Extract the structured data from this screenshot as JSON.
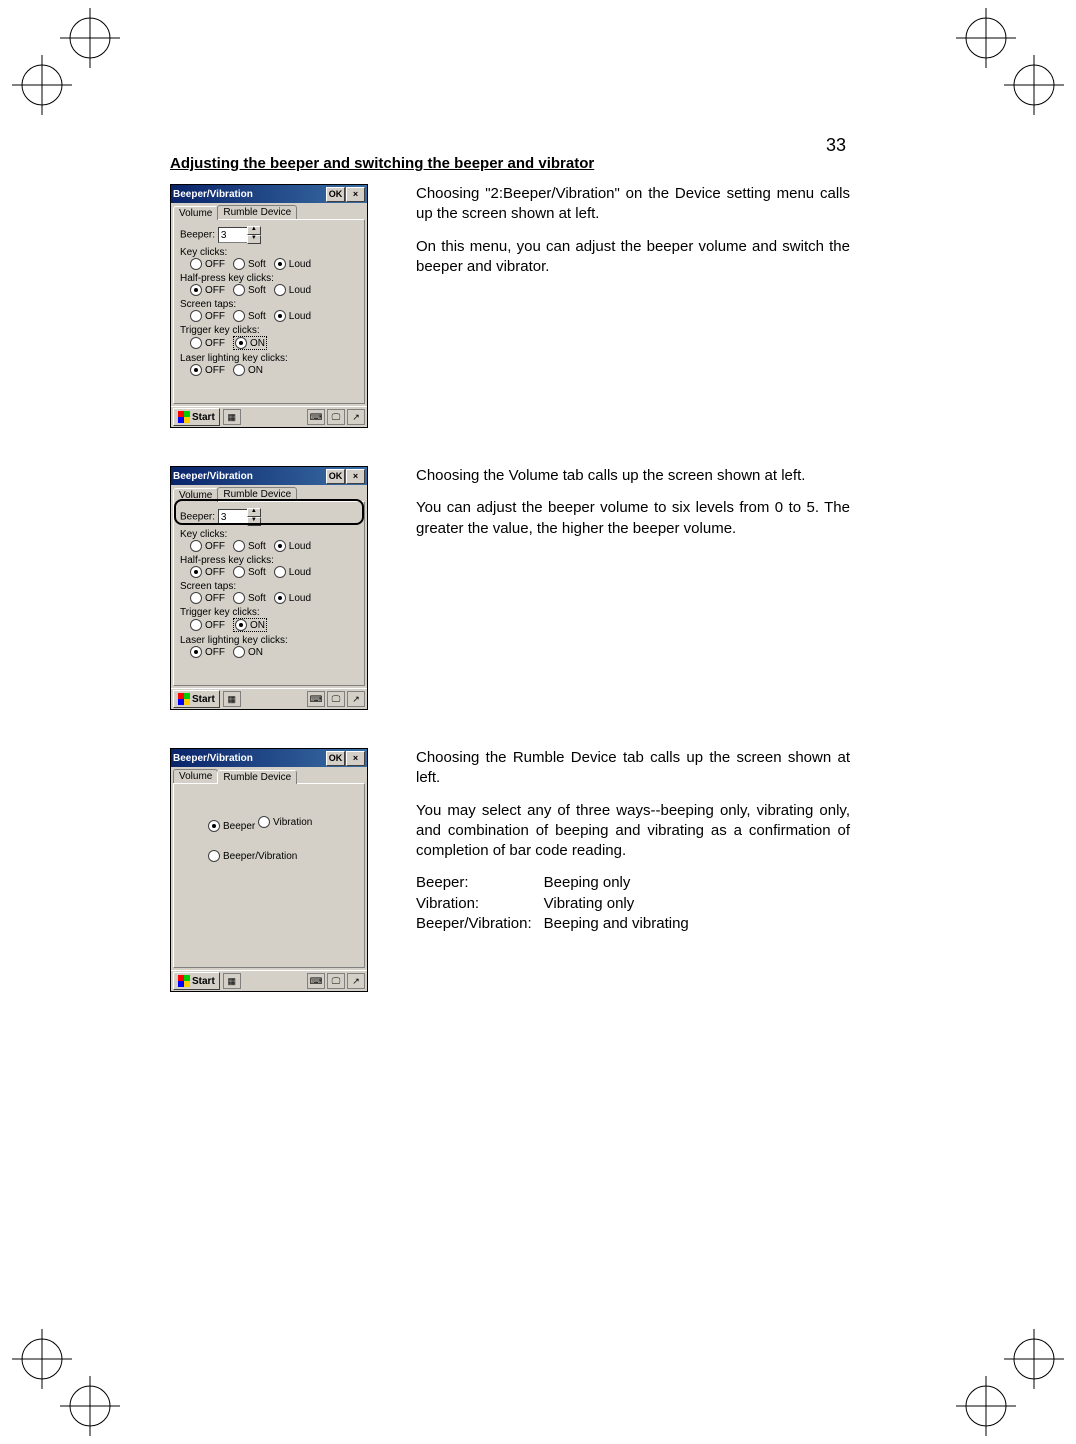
{
  "page_number": "33",
  "section_title": "Adjusting the beeper and switching the beeper and vibrator",
  "blocks": [
    {
      "paragraphs": [
        "Choosing \"2:Beeper/Vibration\" on the Device setting menu calls up the screen shown at left.",
        "On this menu, you can adjust the beeper volume and switch the beeper and vibrator."
      ]
    },
    {
      "paragraphs": [
        "Choosing the Volume tab calls up the screen shown at left.",
        "You can adjust the beeper volume to six levels from 0 to 5. The greater the value, the higher the beeper volume."
      ]
    },
    {
      "paragraphs": [
        "Choosing the Rumble Device tab calls up the screen shown at left.",
        "You may select any of three ways--beeping only, vibrating only, and combination of beeping and vibrating as a confirmation of completion of bar code reading."
      ],
      "defs": [
        {
          "k": "Beeper:",
          "v": "Beeping only"
        },
        {
          "k": "Vibration:",
          "v": "Vibrating only"
        },
        {
          "k": "Beeper/Vibration:",
          "v": "Beeping and vibrating"
        }
      ]
    }
  ],
  "win": {
    "title": "Beeper/Vibration",
    "ok": "OK",
    "close": "×",
    "tabs": {
      "volume": "Volume",
      "rumble": "Rumble Device"
    },
    "beeper_label": "Beeper:",
    "beeper_value": "3",
    "groups": {
      "key": "Key clicks:",
      "half": "Half-press key clicks:",
      "screen": "Screen taps:",
      "trigger": "Trigger key clicks:",
      "laser": "Laser lighting key clicks:"
    },
    "opts": {
      "off": "OFF",
      "soft": "Soft",
      "loud": "Loud",
      "on": "ON"
    },
    "rumble_opts": {
      "beeper": "Beeper",
      "vibration": "Vibration",
      "both": "Beeper/Vibration"
    },
    "start": "Start"
  }
}
